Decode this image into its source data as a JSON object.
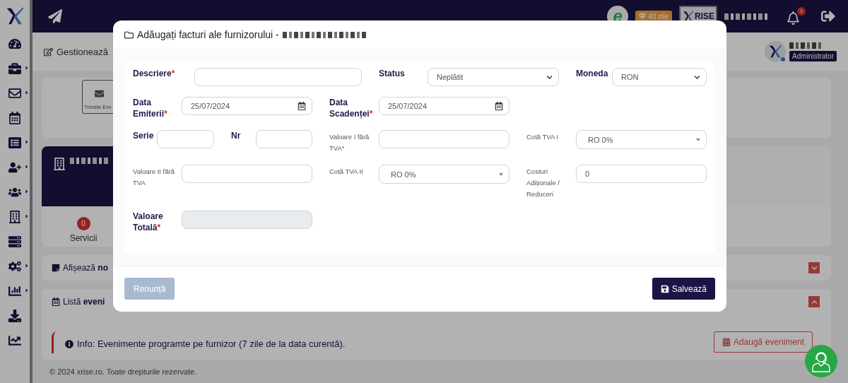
{
  "sidebar": {
    "items": [
      {
        "submenu": false
      },
      {
        "submenu": true
      },
      {
        "submenu": true
      },
      {
        "submenu": false
      },
      {
        "submenu": true
      },
      {
        "submenu": true
      },
      {
        "submenu": true
      },
      {
        "submenu": true
      },
      {
        "submenu": false
      },
      {
        "submenu": true
      },
      {
        "submenu": true
      },
      {
        "submenu": false
      },
      {
        "submenu": false
      }
    ]
  },
  "navbar": {
    "e_logo": "e",
    "trial_badge": "40 zile",
    "logo_text": "RISE",
    "notifications": "1"
  },
  "header": {
    "title": "Gestionează",
    "role": "Administrator"
  },
  "send_card": {
    "button": "Trimite Em"
  },
  "supplier_card": {
    "count": "0",
    "label": "Servicii"
  },
  "notes_panel": {
    "title": "Afișează **no**",
    "expanded": false
  },
  "events_panel": {
    "title": "Listă **eveni**",
    "expanded": true,
    "info": "Info: Evenimente programte pe furnizor (7 zile de la data curentă).",
    "add_button": "Adaugă eveniment"
  },
  "footer": "© 2024 xrise.ro. Toate drepturile rezervate.",
  "modal": {
    "title": "Adăugați facturi ale furnizorului -",
    "rows": [
      [
        {
          "label": "Descriere",
          "required_mark": "*",
          "small_label": false,
          "kind": "input",
          "disabled": false
        },
        {
          "label": "Status",
          "small_label": false,
          "kind": "select",
          "value": "Neplătit",
          "disabled": false
        },
        {
          "label": "Moneda",
          "small_label": false,
          "kind": "select",
          "value": "RON",
          "disabled": false
        }
      ],
      [
        {
          "label": "Data Emiterii",
          "required_mark": "*",
          "small_label": false,
          "kind": "date",
          "value": "25/07/2024",
          "disabled": false
        },
        {
          "label": "Data Scadenței",
          "required_mark": "*",
          "small_label": false,
          "kind": "date",
          "value": "25/07/2024",
          "disabled": false
        }
      ],
      [
        {
          "kind": "pair",
          "fields": [
            {
              "label": "Serie",
              "small_label": false,
              "kind": "input",
              "disabled": false
            },
            {
              "label": "Nr",
              "small_label": false,
              "kind": "input",
              "disabled": false
            }
          ]
        },
        {
          "label": "Valoare I fără TVA",
          "required_mark": "*",
          "small_label": true,
          "kind": "input",
          "disabled": false
        },
        {
          "label": "Cotă TVA I",
          "small_label": true,
          "kind": "combo",
          "value": "RO 0%",
          "disabled": false
        }
      ],
      [
        {
          "label": "Valoare II fără TVA",
          "small_label": true,
          "kind": "input",
          "disabled": false
        },
        {
          "label": "Cotă TVA II",
          "small_label": true,
          "kind": "combo",
          "value": "RO 0%",
          "disabled": false
        },
        {
          "label": "Costuri Adiționale / Reduceri",
          "small_label": true,
          "kind": "input",
          "value": "0",
          "disabled": false
        }
      ],
      [
        {
          "label": "Valoare Totală",
          "required_mark": "*",
          "small_label": false,
          "kind": "input",
          "disabled": true
        }
      ]
    ],
    "cancel": "Renunță",
    "save": "Salvează"
  }
}
